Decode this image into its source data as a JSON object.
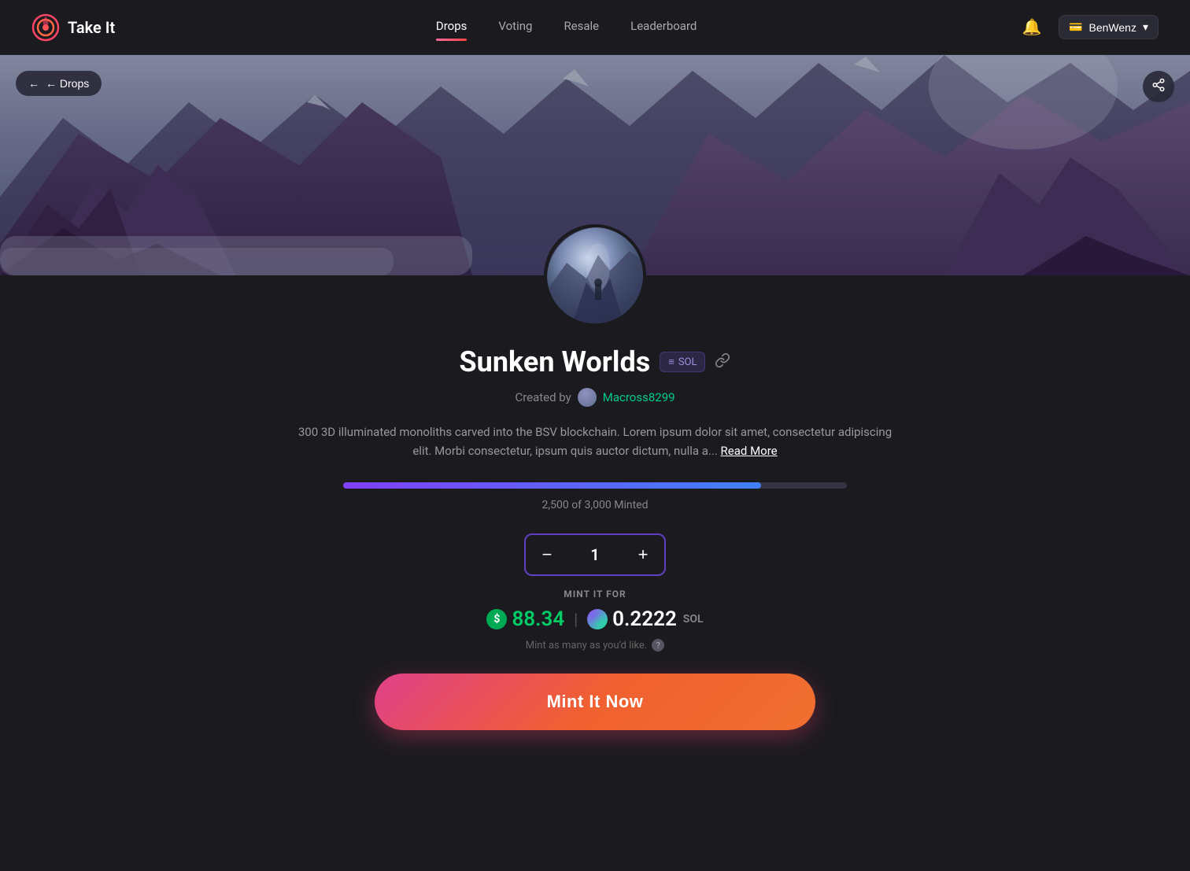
{
  "header": {
    "logo_text": "Take It",
    "nav": [
      {
        "label": "Drops",
        "active": true
      },
      {
        "label": "Voting",
        "active": false
      },
      {
        "label": "Resale",
        "active": false
      },
      {
        "label": "Leaderboard",
        "active": false
      }
    ],
    "user_label": "BenWenz",
    "wallet_icon": "💳"
  },
  "banner": {
    "back_label": "← Drops",
    "share_label": "↗"
  },
  "collection": {
    "title": "Sunken Worlds",
    "sol_badge": "≡ SOL",
    "created_by_label": "Created by",
    "creator_name": "Macross8299",
    "description": "300 3D illuminated monoliths carved into the BSV blockchain. Lorem ipsum dolor sit amet, consectetur adipiscing elit. Morbi consectetur, ipsum quis auctor dictum, nulla a...",
    "read_more_label": "Read More",
    "progress": {
      "minted": 2500,
      "total": 3000,
      "label": "2,500 of 3,000 Minted",
      "percent": 83
    },
    "stepper": {
      "value": 1,
      "decrement_label": "−",
      "increment_label": "+"
    },
    "mint_label": "MINT IT FOR",
    "usd_price": "88.34",
    "sol_price": "0.2222",
    "sol_unit": "SOL",
    "hint_text": "Mint as many as you'd like.",
    "mint_button_label": "Mint It Now"
  },
  "colors": {
    "accent": "#ff4488",
    "success": "#00cc66",
    "sol": "#9945ff",
    "progress_start": "#8040ff",
    "progress_end": "#4080ff",
    "mint_btn_start": "#e0408a",
    "mint_btn_end": "#f07030"
  }
}
